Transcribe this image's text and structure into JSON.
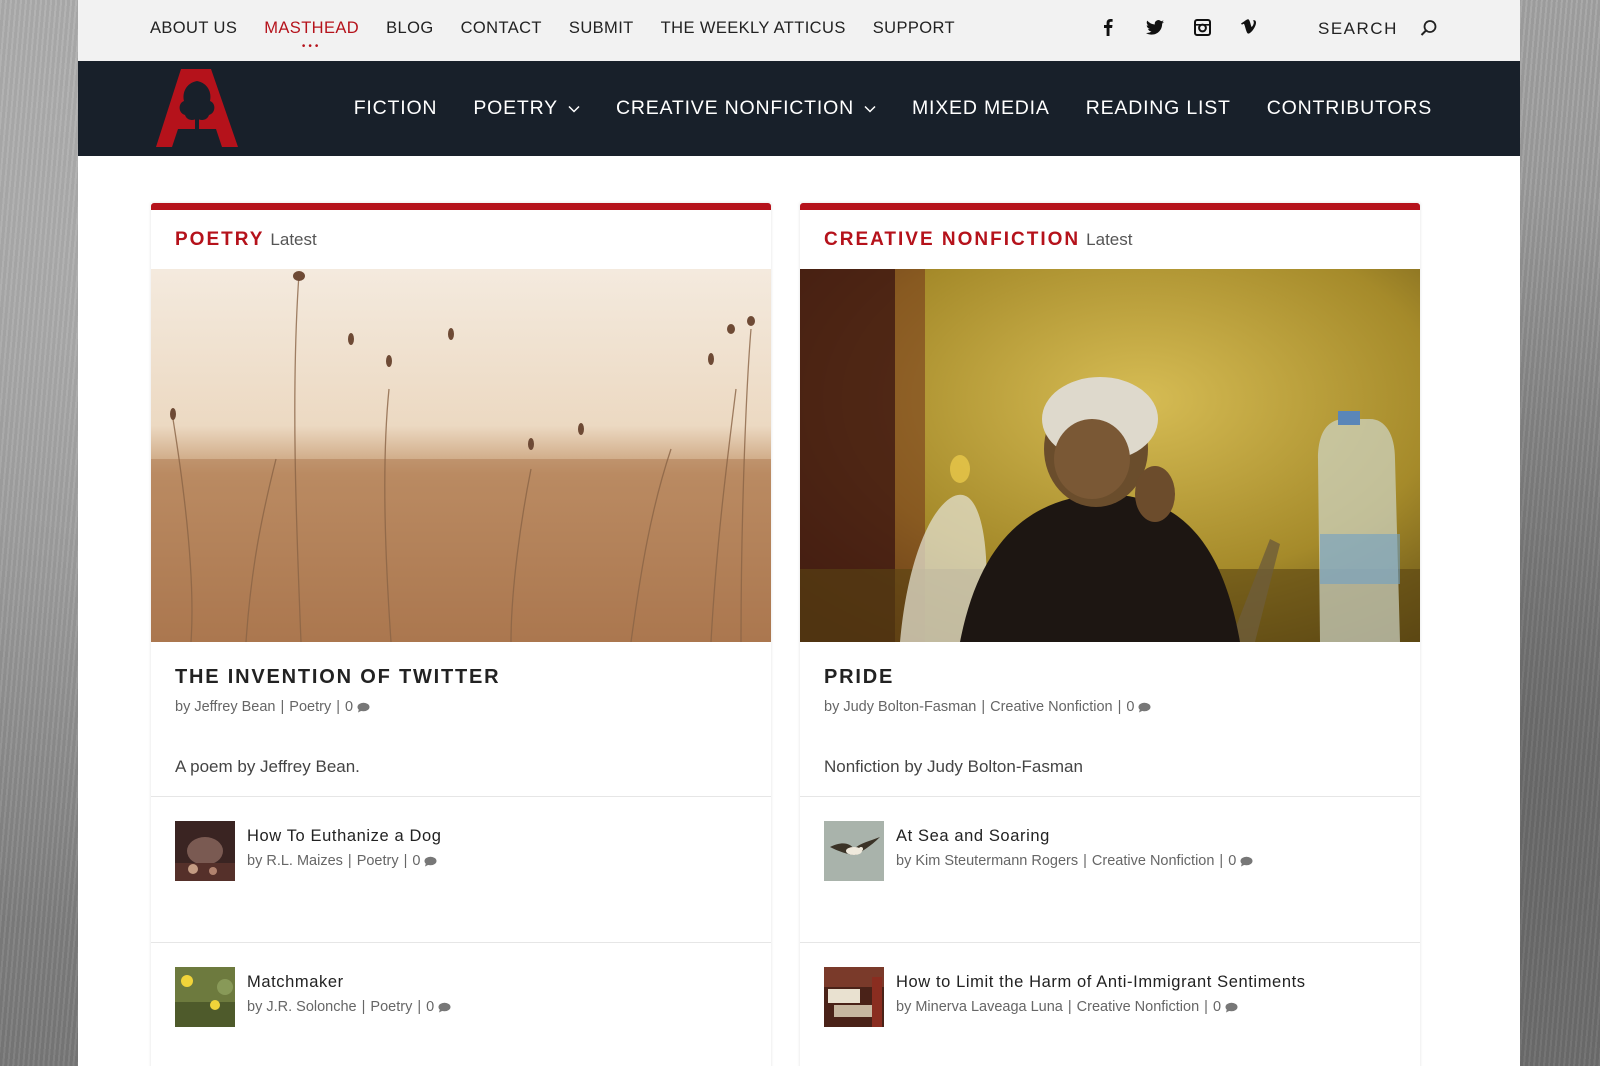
{
  "top_nav": {
    "links": [
      {
        "label": "ABOUT US"
      },
      {
        "label": "MASTHEAD",
        "active": true
      },
      {
        "label": "BLOG"
      },
      {
        "label": "CONTACT"
      },
      {
        "label": "SUBMIT"
      },
      {
        "label": "THE WEEKLY ATTICUS"
      },
      {
        "label": "SUPPORT"
      }
    ],
    "social": [
      "facebook-icon",
      "twitter-icon",
      "instagram-icon",
      "vimeo-icon"
    ],
    "search_label": "SEARCH"
  },
  "main_nav": {
    "items": [
      {
        "label": "FICTION"
      },
      {
        "label": "POETRY",
        "dropdown": true
      },
      {
        "label": "CREATIVE NONFICTION",
        "dropdown": true
      },
      {
        "label": "MIXED MEDIA"
      },
      {
        "label": "READING LIST"
      },
      {
        "label": "CONTRIBUTORS"
      }
    ]
  },
  "colors": {
    "accent": "#b5121b",
    "nav_bg": "#18202a"
  },
  "columns": {
    "poetry": {
      "category": "POETRY",
      "latest": "Latest",
      "feature": {
        "title": "THE INVENTION OF TWITTER",
        "author": "by Jeffrey Bean",
        "category": "Poetry",
        "comments": "0",
        "excerpt": "A poem by Jeffrey Bean."
      },
      "list": [
        {
          "title": "How To Euthanize a Dog",
          "author": "by R.L. Maizes",
          "category": "Poetry",
          "comments": "0"
        },
        {
          "title": "Matchmaker",
          "author": "by J.R. Solonche",
          "category": "Poetry",
          "comments": "0"
        }
      ]
    },
    "nonfiction": {
      "category": "CREATIVE NONFICTION",
      "latest": "Latest",
      "feature": {
        "title": "PRIDE",
        "author": "by Judy Bolton-Fasman",
        "category": "Creative Nonfiction",
        "comments": "0",
        "excerpt": "Nonfiction by Judy Bolton-Fasman"
      },
      "list": [
        {
          "title": "At Sea and Soaring",
          "author": "by Kim Steutermann Rogers",
          "category": "Creative Nonfiction",
          "comments": "0"
        },
        {
          "title": "How to Limit the Harm of Anti-Immigrant Sentiments",
          "author": "by Minerva Laveaga Luna",
          "category": "Creative Nonfiction",
          "comments": "0"
        }
      ]
    }
  }
}
